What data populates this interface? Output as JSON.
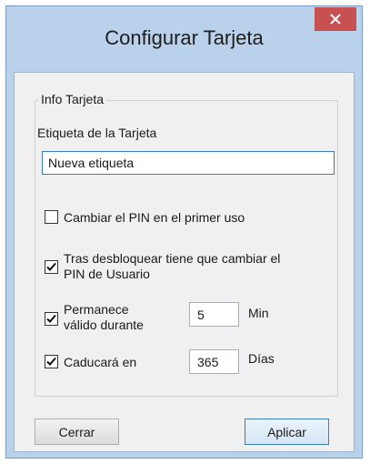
{
  "window": {
    "title": "Configurar Tarjeta"
  },
  "group": {
    "legend": "Info Tarjeta",
    "label_field": "Etiqueta de la Tarjeta",
    "label_value": "Nueva etiqueta"
  },
  "options": {
    "change_pin_first_use": {
      "label": "Cambiar el PIN en el primer uso",
      "checked": false
    },
    "after_unlock_line1": "Tras desbloquear tiene que cambiar el",
    "after_unlock_line2": "PIN de Usuario",
    "after_unlock_checked": true,
    "valid_line1": "Permanece",
    "valid_line2": "válido durante",
    "valid_checked": true,
    "valid_value": "5",
    "valid_unit": "Min",
    "expires_label": "Caducará en",
    "expires_checked": true,
    "expires_value": "365",
    "expires_unit": "Días"
  },
  "buttons": {
    "close": "Cerrar",
    "apply": "Aplicar"
  }
}
